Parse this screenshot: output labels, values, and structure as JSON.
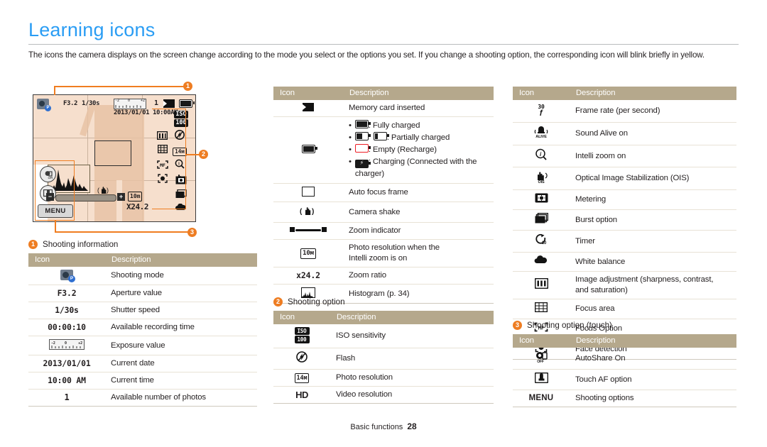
{
  "page": {
    "title": "Learning icons",
    "intro": "The icons the camera displays on the screen change according to the mode you select or the options you set. If you change a shooting option, the corresponding icon will blink briefly in yellow.",
    "footer_label": "Basic functions",
    "footer_page": "28",
    "accent_blue": "#2a9df4",
    "accent_orange": "#ee7d22",
    "table_header_bg": "#b5a88c",
    "screen_bg": "#f6dfcd"
  },
  "camera_screen": {
    "aperture": "F3.2",
    "shutter": "1/30s",
    "date": "2013/01/01",
    "time": "10:00AM",
    "photos_remaining": "1",
    "zoom_ratio": "X24.2",
    "resolution_badge": "10m",
    "iso_badge_top": "ISO",
    "iso_badge_bottom": "100",
    "menu_label": "MENU",
    "exposure_marks": "-2   0   +2",
    "markers": [
      "1",
      "2",
      "3"
    ]
  },
  "sections": [
    {
      "num": "1",
      "caption": "Shooting information"
    },
    {
      "num": "2",
      "caption": "Shooting option"
    },
    {
      "num": "3",
      "caption": "Shooting option (touch)"
    }
  ],
  "columns": {
    "icon": "Icon",
    "description": "Description"
  },
  "table_shooting_information": [
    {
      "icon": "shooting-mode-icon",
      "icon_text": "",
      "desc": "Shooting mode"
    },
    {
      "icon": "aperture-value-text",
      "icon_text": "F3.2",
      "desc": "Aperture value"
    },
    {
      "icon": "shutter-speed-text",
      "icon_text": "1/30s",
      "desc": "Shutter speed"
    },
    {
      "icon": "recording-time-text",
      "icon_text": "00:00:10",
      "desc": "Available recording time"
    },
    {
      "icon": "exposure-value-icon",
      "icon_text": "",
      "desc": "Exposure value"
    },
    {
      "icon": "current-date-text",
      "icon_text": "2013/01/01",
      "desc": "Current date"
    },
    {
      "icon": "current-time-text",
      "icon_text": "10:00 AM",
      "desc": "Current time"
    },
    {
      "icon": "photo-count-text",
      "icon_text": "1",
      "desc": "Available number of photos"
    }
  ],
  "table_icons_middle": [
    {
      "icon": "memory-card-icon",
      "desc": "Memory card inserted"
    },
    {
      "icon": "battery-icon",
      "desc": "",
      "bullets": [
        {
          "icon": "battery-full-icon",
          "text": ": Fully charged"
        },
        {
          "icon": "battery-partial-icon",
          "text": ": Partially charged"
        },
        {
          "icon": "battery-empty-icon",
          "text": ": Empty (Recharge)"
        },
        {
          "icon": "battery-charging-icon",
          "text": ": Charging (Connected with the charger)"
        }
      ]
    },
    {
      "icon": "auto-focus-frame-icon",
      "desc": "Auto focus frame"
    },
    {
      "icon": "camera-shake-icon",
      "desc": "Camera shake"
    },
    {
      "icon": "zoom-indicator-icon",
      "desc": "Zoom indicator"
    },
    {
      "icon": "photo-resolution-intelli-icon",
      "desc": "Photo resolution when the Intelli zoom is on",
      "desc_line1": "Photo resolution when the",
      "desc_line2": "Intelli zoom is on"
    },
    {
      "icon": "zoom-ratio-text",
      "icon_text": "x24.2",
      "desc": "Zoom ratio"
    },
    {
      "icon": "histogram-icon",
      "desc": "Histogram (p. 34)"
    }
  ],
  "table_shooting_option": [
    {
      "icon": "iso-sensitivity-icon",
      "desc": "ISO sensitivity"
    },
    {
      "icon": "flash-icon",
      "desc": "Flash"
    },
    {
      "icon": "photo-resolution-icon",
      "desc": "Photo resolution"
    },
    {
      "icon": "video-resolution-icon",
      "icon_text": "HD",
      "desc": "Video resolution"
    }
  ],
  "table_shooting_option_right": [
    {
      "icon": "frame-rate-icon",
      "desc": "Frame rate (per second)"
    },
    {
      "icon": "sound-alive-icon",
      "desc": "Sound Alive on"
    },
    {
      "icon": "intelli-zoom-icon",
      "desc": "Intelli zoom on"
    },
    {
      "icon": "ois-icon",
      "desc": "Optical Image Stabilization (OIS)"
    },
    {
      "icon": "metering-icon",
      "desc": "Metering"
    },
    {
      "icon": "burst-option-icon",
      "desc": "Burst option"
    },
    {
      "icon": "timer-icon",
      "desc": "Timer"
    },
    {
      "icon": "white-balance-icon",
      "desc": "White balance"
    },
    {
      "icon": "image-adjustment-icon",
      "desc": "Image adjustment (sharpness, contrast, and saturation)",
      "desc_line1": "Image adjustment (sharpness, contrast,",
      "desc_line2": "and saturation)"
    },
    {
      "icon": "focus-area-icon",
      "desc": "Focus area"
    },
    {
      "icon": "focus-option-icon",
      "desc": "Focus Option"
    },
    {
      "icon": "face-detection-icon",
      "desc": "Face detection"
    }
  ],
  "table_shooting_option_touch": [
    {
      "icon": "autoshare-icon",
      "desc": "AutoShare On"
    },
    {
      "icon": "touch-af-icon",
      "desc": "Touch AF option"
    },
    {
      "icon": "menu-icon",
      "icon_text": "MENU",
      "desc": "Shooting options"
    }
  ]
}
